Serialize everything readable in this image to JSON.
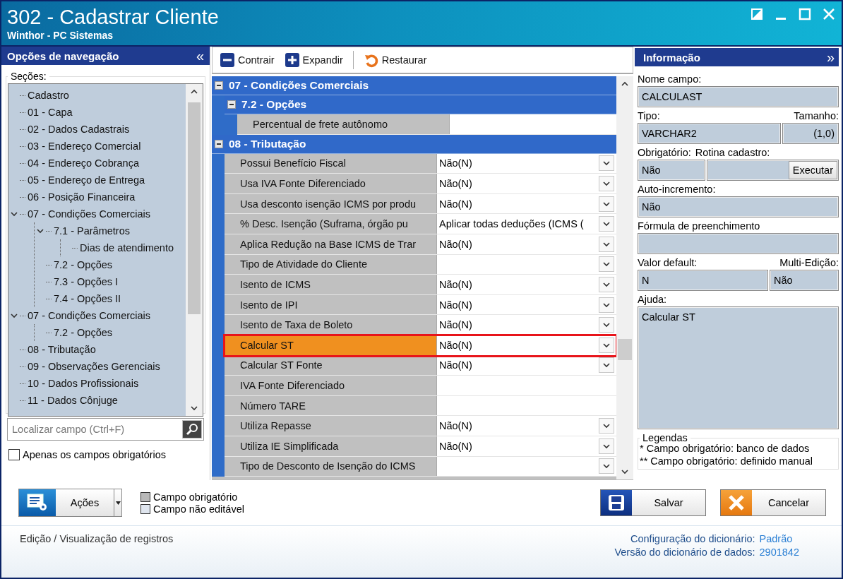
{
  "window": {
    "title": "302 - Cadastrar Cliente",
    "subtitle": "Winthor - PC Sistemas"
  },
  "navigation": {
    "title": "Opções de navegação",
    "collapse": "«",
    "sections_label": "Seções:",
    "tree": [
      {
        "label": "Cadastro"
      },
      {
        "label": "01 - Capa"
      },
      {
        "label": "02 - Dados Cadastrais"
      },
      {
        "label": "03 - Endereço Comercial"
      },
      {
        "label": "04 - Endereço Cobrança"
      },
      {
        "label": "05 - Endereço de Entrega"
      },
      {
        "label": "06 - Posição Financeira"
      },
      {
        "label": "07 - Condições Comerciais",
        "expanded": true,
        "children": [
          {
            "label": "7.1 - Parâmetros",
            "expanded": true,
            "children": [
              {
                "label": "Dias de atendimento"
              }
            ]
          },
          {
            "label": "7.2 - Opções"
          },
          {
            "label": "7.3 - Opções I"
          },
          {
            "label": "7.4 - Opções II"
          }
        ]
      },
      {
        "label": "07 - Condições Comerciais",
        "expanded": true,
        "children": [
          {
            "label": "7.2 - Opções"
          }
        ]
      },
      {
        "label": "08 - Tributação"
      },
      {
        "label": "09 - Observações Gerenciais"
      },
      {
        "label": "10 - Dados Profissionais"
      },
      {
        "label": "11 - Dados Cônjuge"
      }
    ],
    "search": {
      "placeholder": "Localizar campo (Ctrl+F)"
    },
    "required_only": {
      "label": "Apenas os campos obrigatórios",
      "checked": false
    }
  },
  "toolbar": [
    {
      "kind": "collapse",
      "label": "Contrair"
    },
    {
      "kind": "expand",
      "label": "Expandir"
    },
    {
      "kind": "restore",
      "label": "Restaurar"
    }
  ],
  "grid": {
    "groups": [
      {
        "kind": "group",
        "title": "07 - Condições Comerciais",
        "expanded": true,
        "children": [
          {
            "kind": "group",
            "title": "7.2 - Opções",
            "expanded": true,
            "children": [
              {
                "kind": "text",
                "label": "Percentual de frete autônomo",
                "selected": false
              }
            ]
          }
        ]
      },
      {
        "kind": "group",
        "title": "08 - Tributação",
        "expanded": true,
        "children": [
          {
            "kind": "combo",
            "label": "Possui Benefício Fiscal",
            "value": "Não(N)",
            "selected": false
          },
          {
            "kind": "combo",
            "label": "Usa IVA Fonte Diferenciado",
            "value": "Não(N)",
            "selected": false
          },
          {
            "kind": "combo",
            "label": "Usa desconto isenção ICMS por produ",
            "value": "Não(N)",
            "selected": false
          },
          {
            "kind": "combo",
            "label": "% Desc. Isenção (Suframa, órgão pu",
            "value": "Aplicar todas deduções (ICMS (",
            "selected": false
          },
          {
            "kind": "combo",
            "label": "Aplica Redução na Base ICMS de Trar",
            "value": "Não(N)",
            "selected": false
          },
          {
            "kind": "combo",
            "label": "Tipo de Atividade do Cliente",
            "selected": false
          },
          {
            "kind": "combo",
            "label": "Isento de ICMS",
            "value": "Não(N)",
            "selected": false
          },
          {
            "kind": "combo",
            "label": "Isento de IPI",
            "value": "Não(N)",
            "selected": false
          },
          {
            "kind": "combo",
            "label": "Isento de Taxa de Boleto",
            "value": "Não(N)",
            "selected": false
          },
          {
            "kind": "combo",
            "label": "Calcular ST",
            "value": "Não(N)",
            "selected": true
          },
          {
            "kind": "combo",
            "label": "Calcular ST Fonte",
            "value": "Não(N)",
            "selected": false
          },
          {
            "kind": "text",
            "label": "IVA Fonte Diferenciado",
            "selected": false
          },
          {
            "kind": "text",
            "label": "Número TARE",
            "selected": false
          },
          {
            "kind": "combo",
            "label": "Utiliza Repasse",
            "value": "Não(N)",
            "selected": false
          },
          {
            "kind": "combo",
            "label": "Utiliza IE Simplificada",
            "value": "Não(N)",
            "selected": false
          },
          {
            "kind": "combo",
            "label": "Tipo de Desconto de Isenção do ICMS",
            "selected": false
          }
        ]
      }
    ]
  },
  "info": {
    "title": "Informação",
    "expand": "»",
    "field_name_label": "Nome campo:",
    "field_name": "CALCULAST",
    "type_label": "Tipo:",
    "type": "VARCHAR2",
    "size_label": "Tamanho:",
    "size": "(1,0)",
    "required_label": "Obrigatório:",
    "required": "Não",
    "routine_label": "Rotina cadastro:",
    "execute_button": "Executar",
    "autoinc_label": "Auto-incremento:",
    "autoinc": "Não",
    "formula_label": "Fórmula de preenchimento",
    "default_label": "Valor default:",
    "default": "N",
    "multi_label": "Multi-Edição:",
    "multi": "Não",
    "help_label": "Ajuda:",
    "help": "Calcular ST",
    "legend_title": "Legendas",
    "legend": [
      "* Campo obrigatório: banco de dados",
      "** Campo obrigatório: definido manual"
    ]
  },
  "footer": {
    "actions_button": "Ações",
    "legend": [
      {
        "kind": "required",
        "label": "Campo obrigatório"
      },
      {
        "kind": "readonly",
        "label": "Campo não editável"
      }
    ],
    "save_button": "Salvar",
    "cancel_button": "Cancelar"
  },
  "status_bar": {
    "mode": "Edição / Visualização de registros",
    "items": [
      {
        "label": "Configuração do dicionário:",
        "value": "Padrão"
      },
      {
        "label": "Versão do dicionário de dados:",
        "value": "2901842"
      }
    ]
  }
}
